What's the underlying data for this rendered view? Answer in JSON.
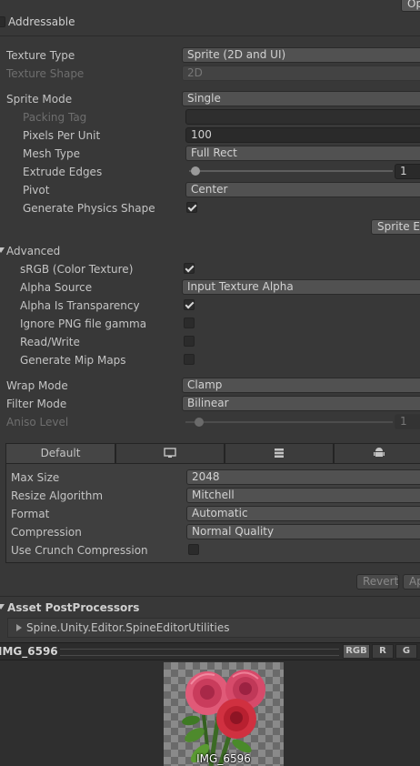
{
  "header": {
    "open_button": "Op",
    "addressable_label": "Addressable"
  },
  "texture": {
    "type_label": "Texture Type",
    "type_value": "Sprite (2D and UI)",
    "shape_label": "Texture Shape",
    "shape_value": "2D",
    "sprite_mode_label": "Sprite Mode",
    "sprite_mode_value": "Single",
    "packing_tag_label": "Packing Tag",
    "packing_tag_value": "",
    "ppu_label": "Pixels Per Unit",
    "ppu_value": "100",
    "mesh_type_label": "Mesh Type",
    "mesh_type_value": "Full Rect",
    "extrude_label": "Extrude Edges",
    "extrude_value": "1",
    "pivot_label": "Pivot",
    "pivot_value": "Center",
    "physics_label": "Generate Physics Shape",
    "physics_checked": true,
    "sprite_editor_button": "Sprite Ed"
  },
  "advanced": {
    "header": "Advanced",
    "srgb_label": "sRGB (Color Texture)",
    "srgb_checked": true,
    "alpha_source_label": "Alpha Source",
    "alpha_source_value": "Input Texture Alpha",
    "alpha_transparency_label": "Alpha Is Transparency",
    "alpha_transparency_checked": true,
    "ignore_png_label": "Ignore PNG file gamma",
    "ignore_png_checked": false,
    "read_write_label": "Read/Write",
    "read_write_checked": false,
    "mip_label": "Generate Mip Maps",
    "mip_checked": false
  },
  "sampling": {
    "wrap_label": "Wrap Mode",
    "wrap_value": "Clamp",
    "filter_label": "Filter Mode",
    "filter_value": "Bilinear",
    "aniso_label": "Aniso Level",
    "aniso_value": "1"
  },
  "platform": {
    "tabs": [
      "Default",
      "monitor-icon",
      "server-icon",
      "android-icon"
    ],
    "max_size_label": "Max Size",
    "max_size_value": "2048",
    "resize_label": "Resize Algorithm",
    "resize_value": "Mitchell",
    "format_label": "Format",
    "format_value": "Automatic",
    "compression_label": "Compression",
    "compression_value": "Normal Quality",
    "crunch_label": "Use Crunch Compression",
    "crunch_checked": false
  },
  "actions": {
    "revert": "Revert",
    "apply": "Ap"
  },
  "postprocessors": {
    "header": "Asset PostProcessors",
    "item": "Spine.Unity.Editor.SpineEditorUtilities"
  },
  "preview": {
    "asset_name": "IMG_6596",
    "channels": [
      "RGB",
      "R",
      "G"
    ],
    "image_label": "IMG_6596"
  },
  "colors": {
    "background": "#383838",
    "field": "#515151",
    "text": "#c4c4c4"
  }
}
